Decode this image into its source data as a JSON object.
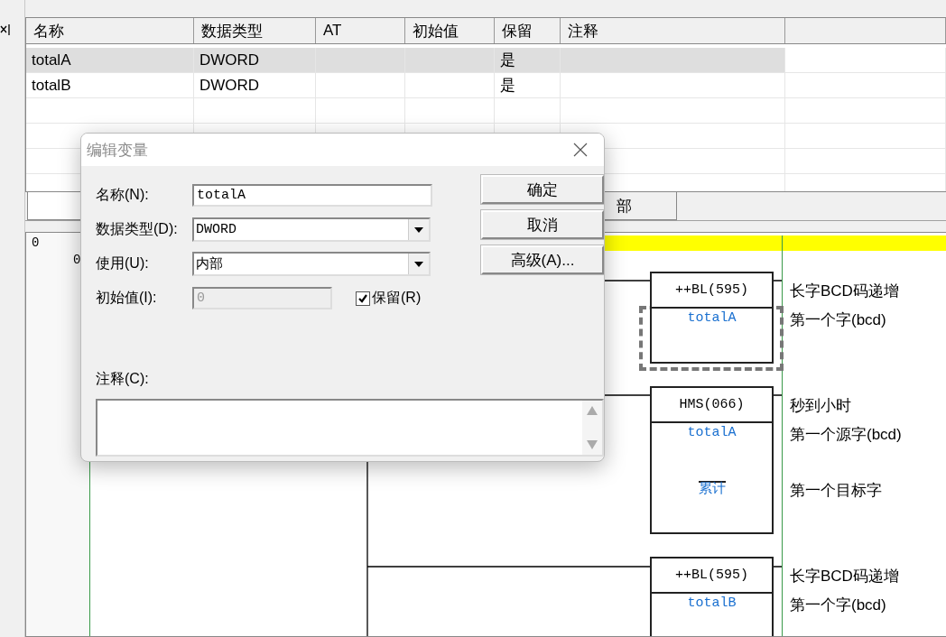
{
  "variable_table": {
    "columns": [
      "名称",
      "数据类型",
      "AT",
      "初始值",
      "保留",
      "注释"
    ],
    "rows": [
      {
        "name": "totalA",
        "data_type": "DWORD",
        "retain": "是",
        "selected": true
      },
      {
        "name": "totalB",
        "data_type": "DWORD",
        "retain": "是",
        "selected": false
      }
    ]
  },
  "tabs": [
    {
      "selected": true
    },
    {
      "label": "部",
      "selected": false
    }
  ],
  "ladder": {
    "rung_numbers": [
      "0",
      "0"
    ],
    "instructions": [
      {
        "mnemonic": "++BL(595)",
        "operands": [
          "totalA"
        ],
        "comments": [
          "长字BCD码递增",
          "第一个字(bcd)"
        ],
        "selected": true
      },
      {
        "mnemonic": "HMS(066)",
        "operands": [
          "totalA",
          "累计"
        ],
        "comments": [
          "秒到小时",
          "第一个源字(bcd)",
          "第一个目标字"
        ],
        "selected": false
      },
      {
        "mnemonic": "++BL(595)",
        "operands": [
          "totalB"
        ],
        "comments": [
          "长字BCD码递增",
          "第一个字(bcd)"
        ],
        "selected": false
      }
    ]
  },
  "dialog": {
    "title": "编辑变量",
    "fields": [
      {
        "kind": "text",
        "label": "名称(N):",
        "value": "totalA",
        "disabled": false
      },
      {
        "kind": "select",
        "label": "数据类型(D):",
        "value": "DWORD",
        "disabled": false
      },
      {
        "kind": "select",
        "label": "使用(U):",
        "value": "内部",
        "disabled": false
      },
      {
        "kind": "text",
        "label": "初始值(I):",
        "value": "0",
        "disabled": true
      }
    ],
    "retain": {
      "label": "保留(R)",
      "checked": true
    },
    "comment_label": "注释(C):",
    "buttons": [
      "确定",
      "取消",
      "高级(A)..."
    ]
  }
}
